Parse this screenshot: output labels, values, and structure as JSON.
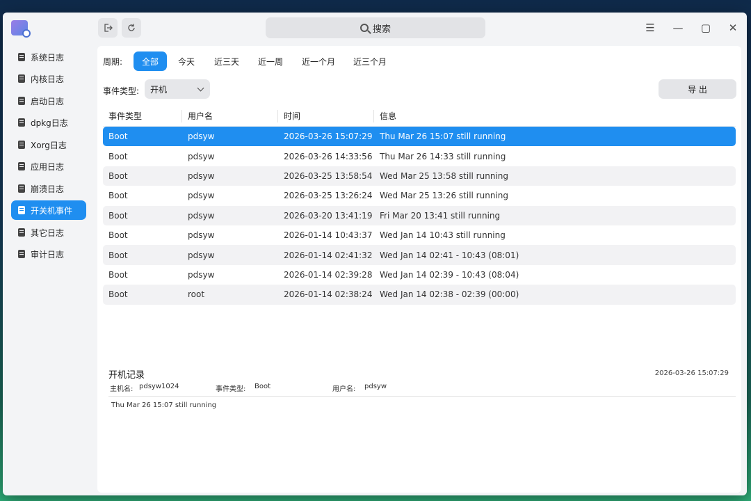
{
  "titlebar": {
    "search_label": "搜索",
    "buttons": [
      "export-log-icon",
      "refresh-icon"
    ],
    "window_controls": [
      "menu-icon",
      "minimize-icon",
      "maximize-icon",
      "close-icon"
    ]
  },
  "sidebar": {
    "items": [
      {
        "label": "系统日志",
        "active": false
      },
      {
        "label": "内核日志",
        "active": false
      },
      {
        "label": "启动日志",
        "active": false
      },
      {
        "label": "dpkg日志",
        "active": false
      },
      {
        "label": "Xorg日志",
        "active": false
      },
      {
        "label": "应用日志",
        "active": false
      },
      {
        "label": "崩溃日志",
        "active": false
      },
      {
        "label": "开关机事件",
        "active": true
      },
      {
        "label": "其它日志",
        "active": false
      },
      {
        "label": "审计日志",
        "active": false
      }
    ]
  },
  "filters": {
    "period_label": "周期:",
    "periods": [
      "全部",
      "今天",
      "近三天",
      "近一周",
      "近一个月",
      "近三个月"
    ],
    "active_period": "全部",
    "event_type_label": "事件类型:",
    "event_type_value": "开机",
    "export_label": "导 出"
  },
  "table": {
    "headers": [
      "事件类型",
      "用户名",
      "时间",
      "信息"
    ],
    "rows": [
      {
        "type": "Boot",
        "user": "pdsyw",
        "time": "2026-03-26 15:07:29",
        "info": "Thu Mar 26 15:07 still running"
      },
      {
        "type": "Boot",
        "user": "pdsyw",
        "time": "2026-03-26 14:33:56",
        "info": "Thu Mar 26 14:33 still running"
      },
      {
        "type": "Boot",
        "user": "pdsyw",
        "time": "2026-03-25 13:58:54",
        "info": "Wed Mar 25 13:58 still running"
      },
      {
        "type": "Boot",
        "user": "pdsyw",
        "time": "2026-03-25 13:26:24",
        "info": "Wed Mar 25 13:26 still running"
      },
      {
        "type": "Boot",
        "user": "pdsyw",
        "time": "2026-03-20 13:41:19",
        "info": "Fri Mar 20 13:41 still running"
      },
      {
        "type": "Boot",
        "user": "pdsyw",
        "time": "2026-01-14 10:43:37",
        "info": "Wed Jan 14 10:43 still running"
      },
      {
        "type": "Boot",
        "user": "pdsyw",
        "time": "2026-01-14 02:41:32",
        "info": "Wed Jan 14 02:41 - 10:43 (08:01)"
      },
      {
        "type": "Boot",
        "user": "pdsyw",
        "time": "2026-01-14 02:39:28",
        "info": "Wed Jan 14 02:39 - 10:43 (08:04)"
      },
      {
        "type": "Boot",
        "user": "root",
        "time": "2026-01-14 02:38:24",
        "info": "Wed Jan 14 02:38 - 02:39 (00:00)"
      }
    ]
  },
  "detail": {
    "title": "开机记录",
    "time": "2026-03-26 15:07:29",
    "hostname_label": "主机名:",
    "hostname": "pdsyw1024",
    "event_type_label": "事件类型:",
    "event_type": "Boot",
    "user_label": "用户名:",
    "user": "pdsyw",
    "message": "Thu Mar 26 15:07 still running"
  },
  "colors": {
    "accent": "#1f8ef0",
    "window_bg": "#f3f4f6",
    "panel_bg": "#ffffff"
  }
}
